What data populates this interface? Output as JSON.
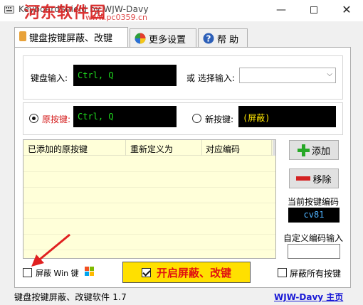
{
  "window": {
    "title": "KeyboardShield by WJW-Davy",
    "min_glyph": "—",
    "close_glyph": "✕",
    "watermark": "河东软件园",
    "watermark_sub": "www.pc0359.cn"
  },
  "tabs": [
    {
      "label": "键盘按键屏蔽、改键",
      "icon": "keyboard-icon",
      "active": true
    },
    {
      "label": "更多设置",
      "icon": "settings-globe-icon",
      "active": false
    },
    {
      "label": "帮 助",
      "icon": "help-icon",
      "active": false
    }
  ],
  "keyboard_input": {
    "label": "键盘输入:",
    "value": "Ctrl, Q",
    "or_select_label": "或 选择输入:",
    "select_value": ""
  },
  "mapping": {
    "original_label": "原按键:",
    "original_value": "Ctrl, Q",
    "original_selected": true,
    "new_label": "新按键:",
    "new_value": "(屏蔽)",
    "new_selected": false
  },
  "table": {
    "columns": [
      "已添加的原按键",
      "重新定义为",
      "对应编码"
    ],
    "rows": []
  },
  "buttons": {
    "add": "添加",
    "remove": "移除",
    "start": "开启屏蔽、改键"
  },
  "code": {
    "current_label": "当前按键编码",
    "current_value": "cv81",
    "custom_label": "自定义编码输入",
    "custom_value": ""
  },
  "options": {
    "block_win_label": "屏蔽 Win 键",
    "block_win_checked": false,
    "block_all_label": "屏蔽所有按键",
    "block_all_checked": false,
    "start_checked": true
  },
  "status": {
    "left": "键盘按键屏蔽、改键软件 1.7",
    "link": "WJW-Davy 主页"
  },
  "colors": {
    "accent_green": "#1fdc1f",
    "accent_yellow": "#ffe600",
    "code_blue": "#4fb3ff",
    "start_bg": "#ffe000",
    "start_text": "#e01010",
    "link_blue": "#1a1ad6",
    "list_bg": "#ffffd9",
    "annotation_arrow": "#e02020"
  }
}
